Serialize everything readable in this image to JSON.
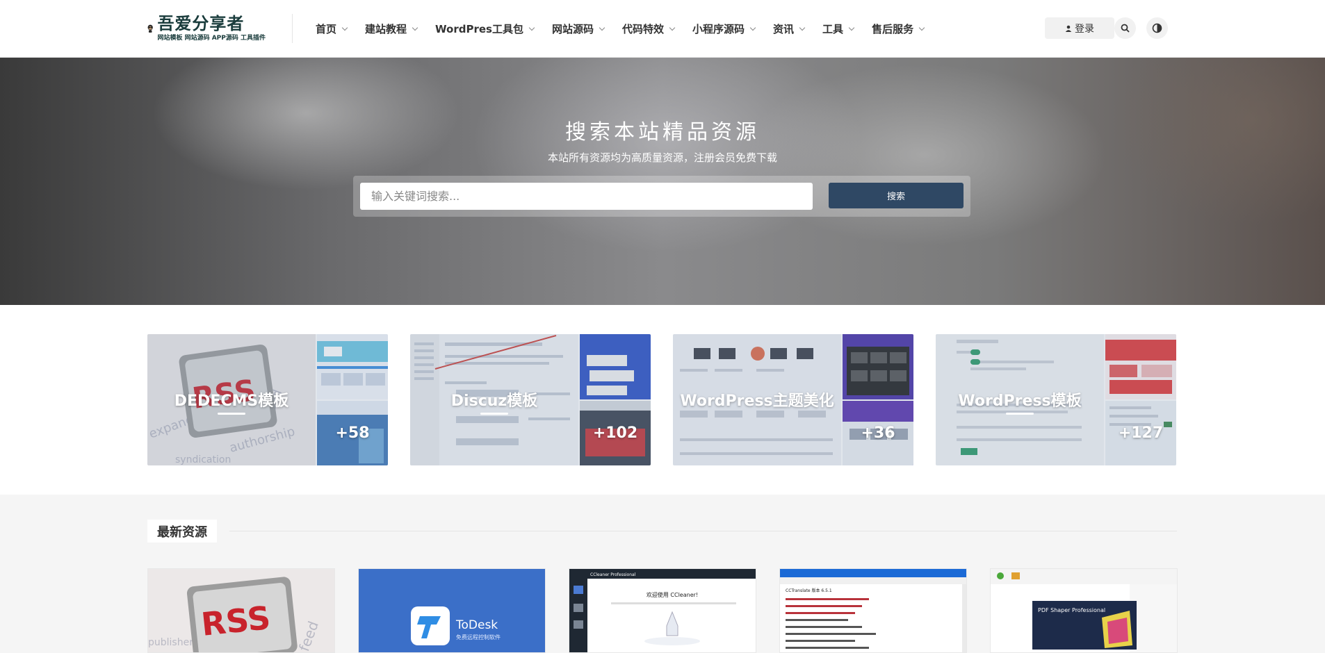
{
  "brand": {
    "title": "吾爱分享者",
    "subtitle": "网站模板 网站源码 APP源码 工具插件"
  },
  "nav": {
    "items": [
      {
        "label": "首页"
      },
      {
        "label": "建站教程"
      },
      {
        "label": "WordPres工具包"
      },
      {
        "label": "网站源码"
      },
      {
        "label": "代码特效"
      },
      {
        "label": "小程序源码"
      },
      {
        "label": "资讯"
      },
      {
        "label": "工具"
      },
      {
        "label": "售后服务"
      }
    ],
    "login_label": "登录"
  },
  "icons": {
    "user": "user-icon",
    "search": "search-icon",
    "theme": "theme-toggle-icon",
    "chevron": "chevron-down-icon"
  },
  "hero": {
    "title": "搜索本站精品资源",
    "subtitle": "本站所有资源均为高质量资源，注册会员免费下载",
    "search_placeholder": "输入关键词搜索...",
    "search_button": "搜索"
  },
  "categories": [
    {
      "title": "DEDECMS模板",
      "count": "+58"
    },
    {
      "title": "Discuz模板",
      "count": "+102"
    },
    {
      "title": "WordPress主题美化",
      "count": "+36"
    },
    {
      "title": "WordPress模板",
      "count": "+127"
    }
  ],
  "latest": {
    "heading": "最新资源",
    "cards": [
      {
        "thumb_text": "RSS"
      },
      {
        "thumb_text": "ToDesk",
        "thumb_sub": "免费远程控制软件"
      },
      {
        "thumb_text": "欢迎使用 CCleaner!",
        "thumb_sub": "CCleaner Professional"
      },
      {
        "thumb_text": "CCTranslate 版本 6.5.1"
      },
      {
        "thumb_text": "PDF Shaper Professional"
      }
    ]
  },
  "colors": {
    "accent": "#2f4864",
    "brand_text": "#1a3c3c",
    "todesk_blue": "#3b6fc8"
  }
}
